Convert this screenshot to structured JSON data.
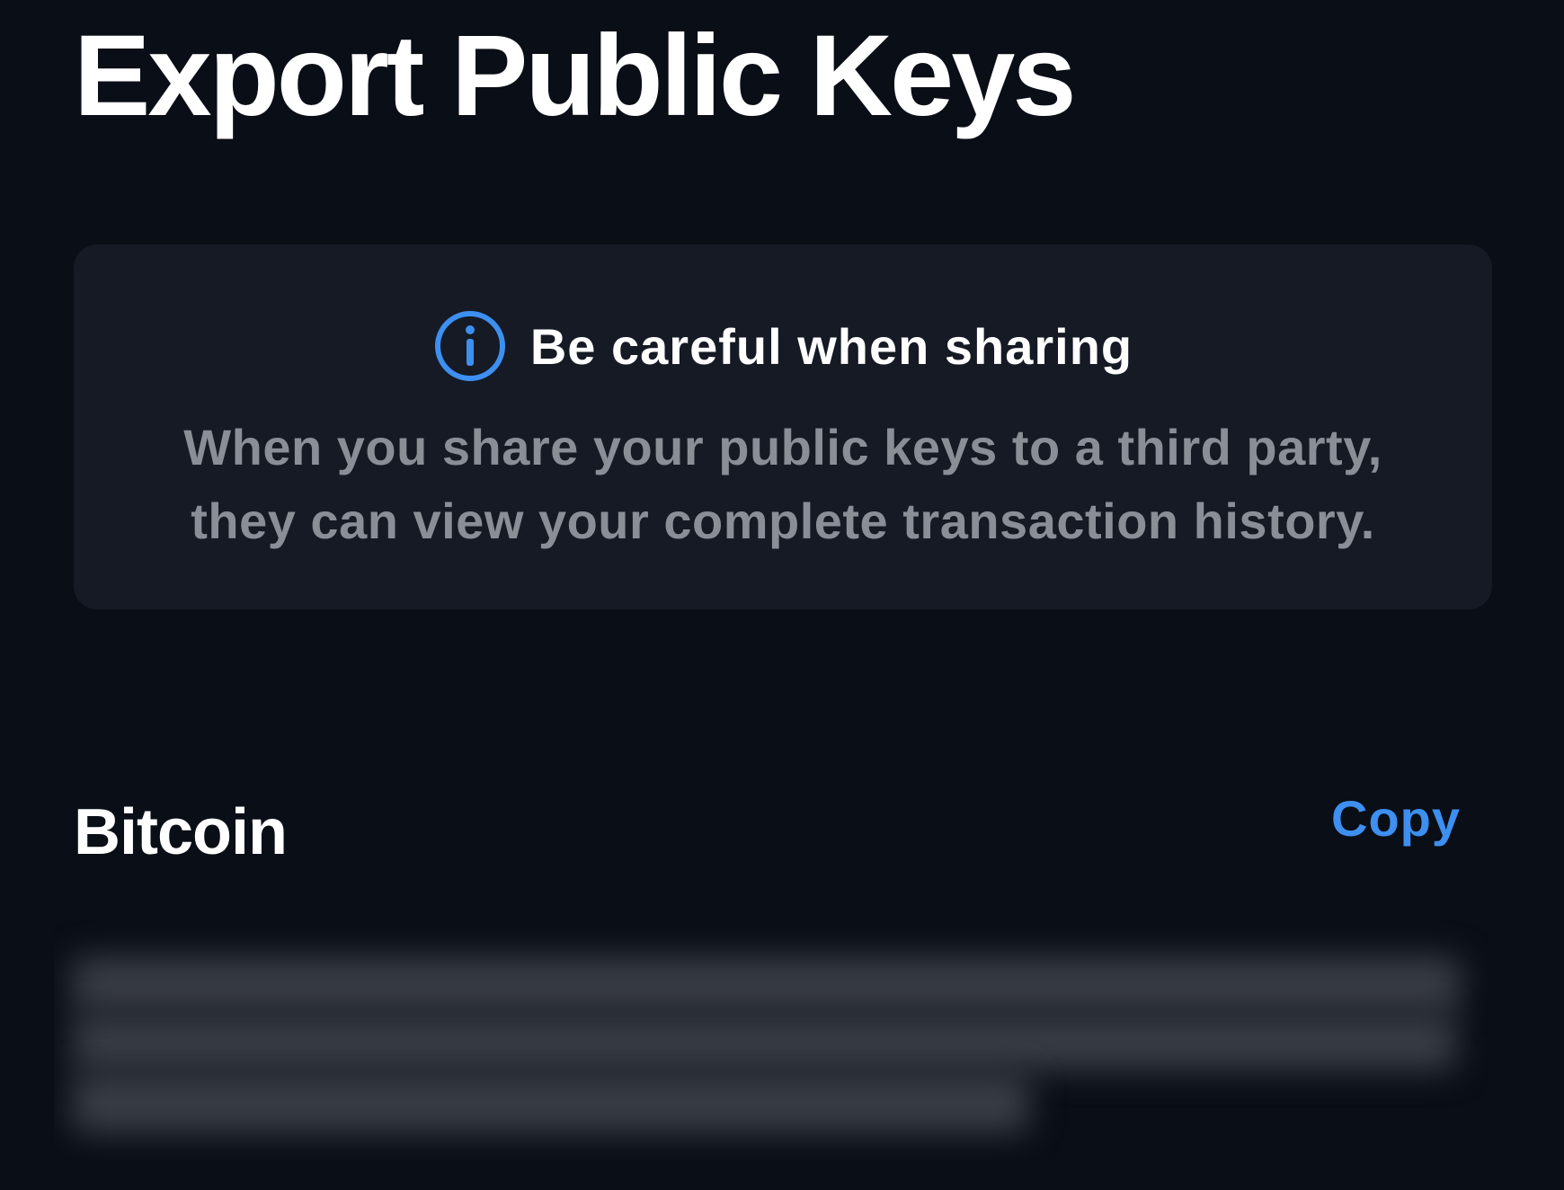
{
  "header": {
    "title": "Export Public Keys"
  },
  "warning": {
    "title": "Be careful when sharing",
    "body_line_1": "When you share your public keys to a third party,",
    "body_line_2": "they can view your complete transaction history.",
    "icon": "info-icon",
    "icon_color": "#3d8ff0"
  },
  "keys_section": {
    "label": "Bitcoin",
    "copy_label": "Copy",
    "public_key_redacted": true
  },
  "colors": {
    "background": "#0a0e16",
    "card": "#151a24",
    "accent": "#3d8ff0",
    "muted_text": "#8a8e97"
  }
}
